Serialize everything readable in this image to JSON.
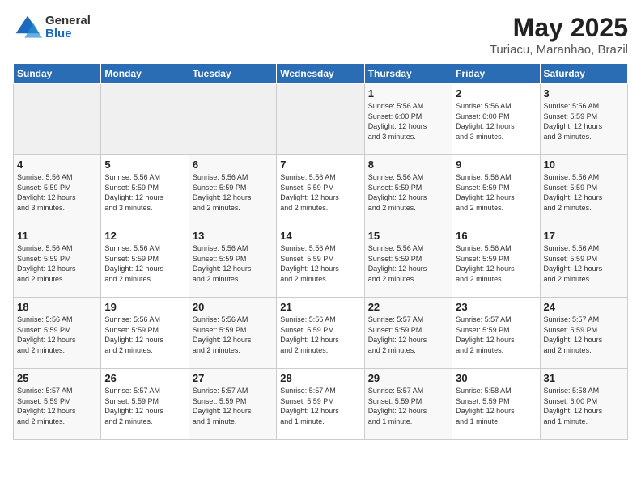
{
  "logo": {
    "general": "General",
    "blue": "Blue"
  },
  "title": "May 2025",
  "subtitle": "Turiacu, Maranhao, Brazil",
  "headers": [
    "Sunday",
    "Monday",
    "Tuesday",
    "Wednesday",
    "Thursday",
    "Friday",
    "Saturday"
  ],
  "weeks": [
    [
      {
        "day": "",
        "info": ""
      },
      {
        "day": "",
        "info": ""
      },
      {
        "day": "",
        "info": ""
      },
      {
        "day": "",
        "info": ""
      },
      {
        "day": "1",
        "info": "Sunrise: 5:56 AM\nSunset: 6:00 PM\nDaylight: 12 hours\nand 3 minutes."
      },
      {
        "day": "2",
        "info": "Sunrise: 5:56 AM\nSunset: 6:00 PM\nDaylight: 12 hours\nand 3 minutes."
      },
      {
        "day": "3",
        "info": "Sunrise: 5:56 AM\nSunset: 5:59 PM\nDaylight: 12 hours\nand 3 minutes."
      }
    ],
    [
      {
        "day": "4",
        "info": "Sunrise: 5:56 AM\nSunset: 5:59 PM\nDaylight: 12 hours\nand 3 minutes."
      },
      {
        "day": "5",
        "info": "Sunrise: 5:56 AM\nSunset: 5:59 PM\nDaylight: 12 hours\nand 3 minutes."
      },
      {
        "day": "6",
        "info": "Sunrise: 5:56 AM\nSunset: 5:59 PM\nDaylight: 12 hours\nand 2 minutes."
      },
      {
        "day": "7",
        "info": "Sunrise: 5:56 AM\nSunset: 5:59 PM\nDaylight: 12 hours\nand 2 minutes."
      },
      {
        "day": "8",
        "info": "Sunrise: 5:56 AM\nSunset: 5:59 PM\nDaylight: 12 hours\nand 2 minutes."
      },
      {
        "day": "9",
        "info": "Sunrise: 5:56 AM\nSunset: 5:59 PM\nDaylight: 12 hours\nand 2 minutes."
      },
      {
        "day": "10",
        "info": "Sunrise: 5:56 AM\nSunset: 5:59 PM\nDaylight: 12 hours\nand 2 minutes."
      }
    ],
    [
      {
        "day": "11",
        "info": "Sunrise: 5:56 AM\nSunset: 5:59 PM\nDaylight: 12 hours\nand 2 minutes."
      },
      {
        "day": "12",
        "info": "Sunrise: 5:56 AM\nSunset: 5:59 PM\nDaylight: 12 hours\nand 2 minutes."
      },
      {
        "day": "13",
        "info": "Sunrise: 5:56 AM\nSunset: 5:59 PM\nDaylight: 12 hours\nand 2 minutes."
      },
      {
        "day": "14",
        "info": "Sunrise: 5:56 AM\nSunset: 5:59 PM\nDaylight: 12 hours\nand 2 minutes."
      },
      {
        "day": "15",
        "info": "Sunrise: 5:56 AM\nSunset: 5:59 PM\nDaylight: 12 hours\nand 2 minutes."
      },
      {
        "day": "16",
        "info": "Sunrise: 5:56 AM\nSunset: 5:59 PM\nDaylight: 12 hours\nand 2 minutes."
      },
      {
        "day": "17",
        "info": "Sunrise: 5:56 AM\nSunset: 5:59 PM\nDaylight: 12 hours\nand 2 minutes."
      }
    ],
    [
      {
        "day": "18",
        "info": "Sunrise: 5:56 AM\nSunset: 5:59 PM\nDaylight: 12 hours\nand 2 minutes."
      },
      {
        "day": "19",
        "info": "Sunrise: 5:56 AM\nSunset: 5:59 PM\nDaylight: 12 hours\nand 2 minutes."
      },
      {
        "day": "20",
        "info": "Sunrise: 5:56 AM\nSunset: 5:59 PM\nDaylight: 12 hours\nand 2 minutes."
      },
      {
        "day": "21",
        "info": "Sunrise: 5:56 AM\nSunset: 5:59 PM\nDaylight: 12 hours\nand 2 minutes."
      },
      {
        "day": "22",
        "info": "Sunrise: 5:57 AM\nSunset: 5:59 PM\nDaylight: 12 hours\nand 2 minutes."
      },
      {
        "day": "23",
        "info": "Sunrise: 5:57 AM\nSunset: 5:59 PM\nDaylight: 12 hours\nand 2 minutes."
      },
      {
        "day": "24",
        "info": "Sunrise: 5:57 AM\nSunset: 5:59 PM\nDaylight: 12 hours\nand 2 minutes."
      }
    ],
    [
      {
        "day": "25",
        "info": "Sunrise: 5:57 AM\nSunset: 5:59 PM\nDaylight: 12 hours\nand 2 minutes."
      },
      {
        "day": "26",
        "info": "Sunrise: 5:57 AM\nSunset: 5:59 PM\nDaylight: 12 hours\nand 2 minutes."
      },
      {
        "day": "27",
        "info": "Sunrise: 5:57 AM\nSunset: 5:59 PM\nDaylight: 12 hours\nand 1 minute."
      },
      {
        "day": "28",
        "info": "Sunrise: 5:57 AM\nSunset: 5:59 PM\nDaylight: 12 hours\nand 1 minute."
      },
      {
        "day": "29",
        "info": "Sunrise: 5:57 AM\nSunset: 5:59 PM\nDaylight: 12 hours\nand 1 minute."
      },
      {
        "day": "30",
        "info": "Sunrise: 5:58 AM\nSunset: 5:59 PM\nDaylight: 12 hours\nand 1 minute."
      },
      {
        "day": "31",
        "info": "Sunrise: 5:58 AM\nSunset: 6:00 PM\nDaylight: 12 hours\nand 1 minute."
      }
    ]
  ]
}
